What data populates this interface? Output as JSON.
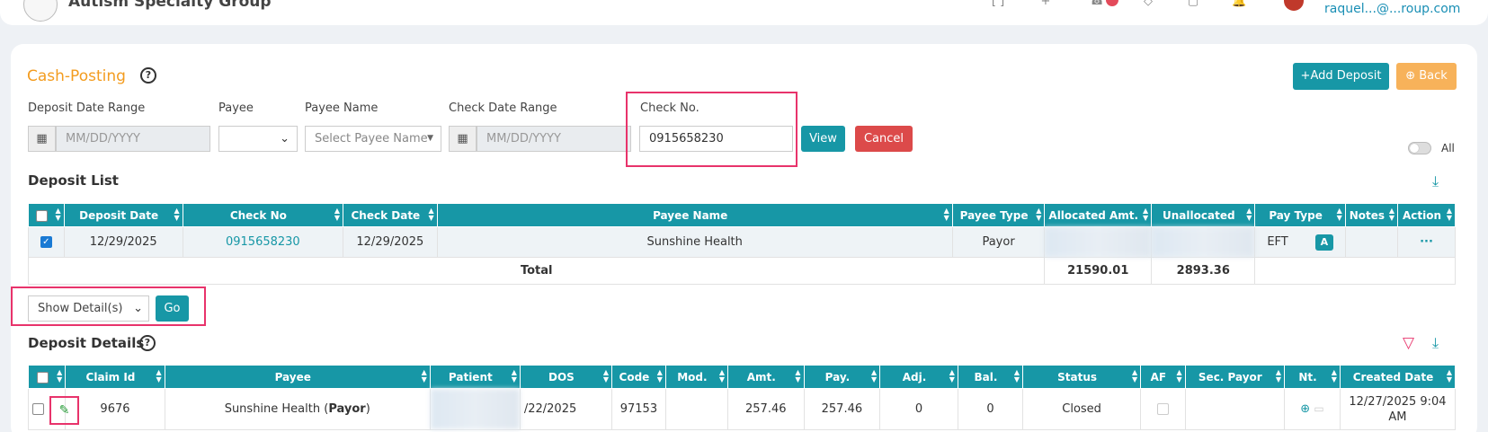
{
  "header": {
    "org_name": "Autism Specialty Group",
    "user_email": "raquel...@...roup.com"
  },
  "page": {
    "title": "Cash-Posting",
    "help": "?",
    "add_deposit": "+Add Deposit",
    "back": "⊕ Back"
  },
  "filters": {
    "deposit_date_range_label": "Deposit Date Range",
    "deposit_date_placeholder": "MM/DD/YYYY",
    "payee_label": "Payee",
    "payee_value": "",
    "payee_name_label": "Payee Name",
    "payee_name_placeholder": "Select Payee Name",
    "check_date_range_label": "Check Date Range",
    "check_date_placeholder": "MM/DD/YYYY",
    "check_no_label": "Check No.",
    "check_no_value": "0915658230",
    "view_label": "View",
    "cancel_label": "Cancel",
    "all_label": "All"
  },
  "deposit_list": {
    "title": "Deposit List",
    "columns": [
      "Deposit Date",
      "Check No",
      "Check Date",
      "Payee Name",
      "Payee Type",
      "Allocated Amt.",
      "Unallocated",
      "Pay Type",
      "Notes",
      "Action"
    ],
    "rows": [
      {
        "deposit_date": "12/29/2025",
        "check_no": "0915658230",
        "check_date": "12/29/2025",
        "payee_name": "Sunshine Health",
        "payee_type": "Payor",
        "pay_type": "EFT",
        "pay_badge": "A",
        "action": "···"
      }
    ],
    "total_label": "Total",
    "total_allocated": "21590.01",
    "total_unallocated": "2893.36"
  },
  "detail_select": {
    "value": "Show Detail(s)",
    "go_label": "Go"
  },
  "deposit_details": {
    "title": "Deposit Details",
    "columns": [
      "Claim Id",
      "Payee",
      "Patient",
      "DOS",
      "Code",
      "Mod.",
      "Amt.",
      "Pay.",
      "Adj.",
      "Bal.",
      "Status",
      "AF",
      "Sec. Payor",
      "Nt.",
      "Created Date"
    ],
    "rows": [
      {
        "claim_id": "9676",
        "payee": "Sunshine Health (",
        "payee_bold": "Payor",
        "payee_end": ")",
        "dos": "/22/2025",
        "code": "97153",
        "mod": "",
        "amt": "257.46",
        "pay": "257.46",
        "adj": "0",
        "bal": "0",
        "status": "Closed",
        "created_1": "12/27/2025 9:04",
        "created_2": "AM"
      }
    ]
  },
  "colors": {
    "teal": "#1797a6",
    "orange": "#f39c1f",
    "red": "#dc4a4a",
    "highlight": "#e8336b"
  }
}
